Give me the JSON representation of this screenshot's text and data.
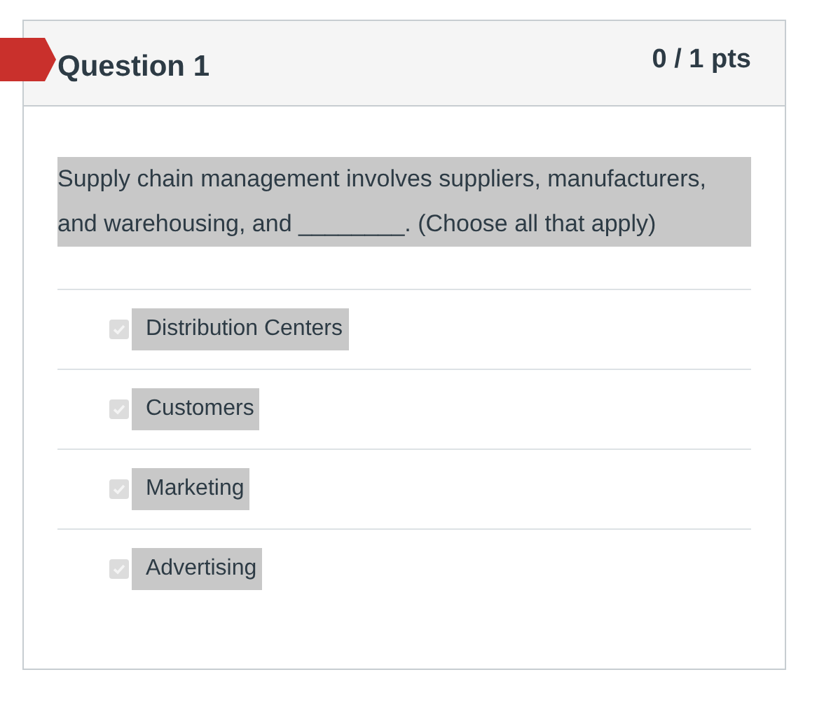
{
  "question": {
    "title": "Question 1",
    "points": "0 / 1 pts",
    "text": "Supply chain management involves suppliers, manufacturers, and warehousing, and ________. (Choose all that apply)",
    "options": [
      {
        "label": "Distribution Centers",
        "checked": true
      },
      {
        "label": "Customers",
        "checked": true
      },
      {
        "label": "Marketing",
        "checked": true
      },
      {
        "label": "Advertising",
        "checked": true
      }
    ]
  }
}
